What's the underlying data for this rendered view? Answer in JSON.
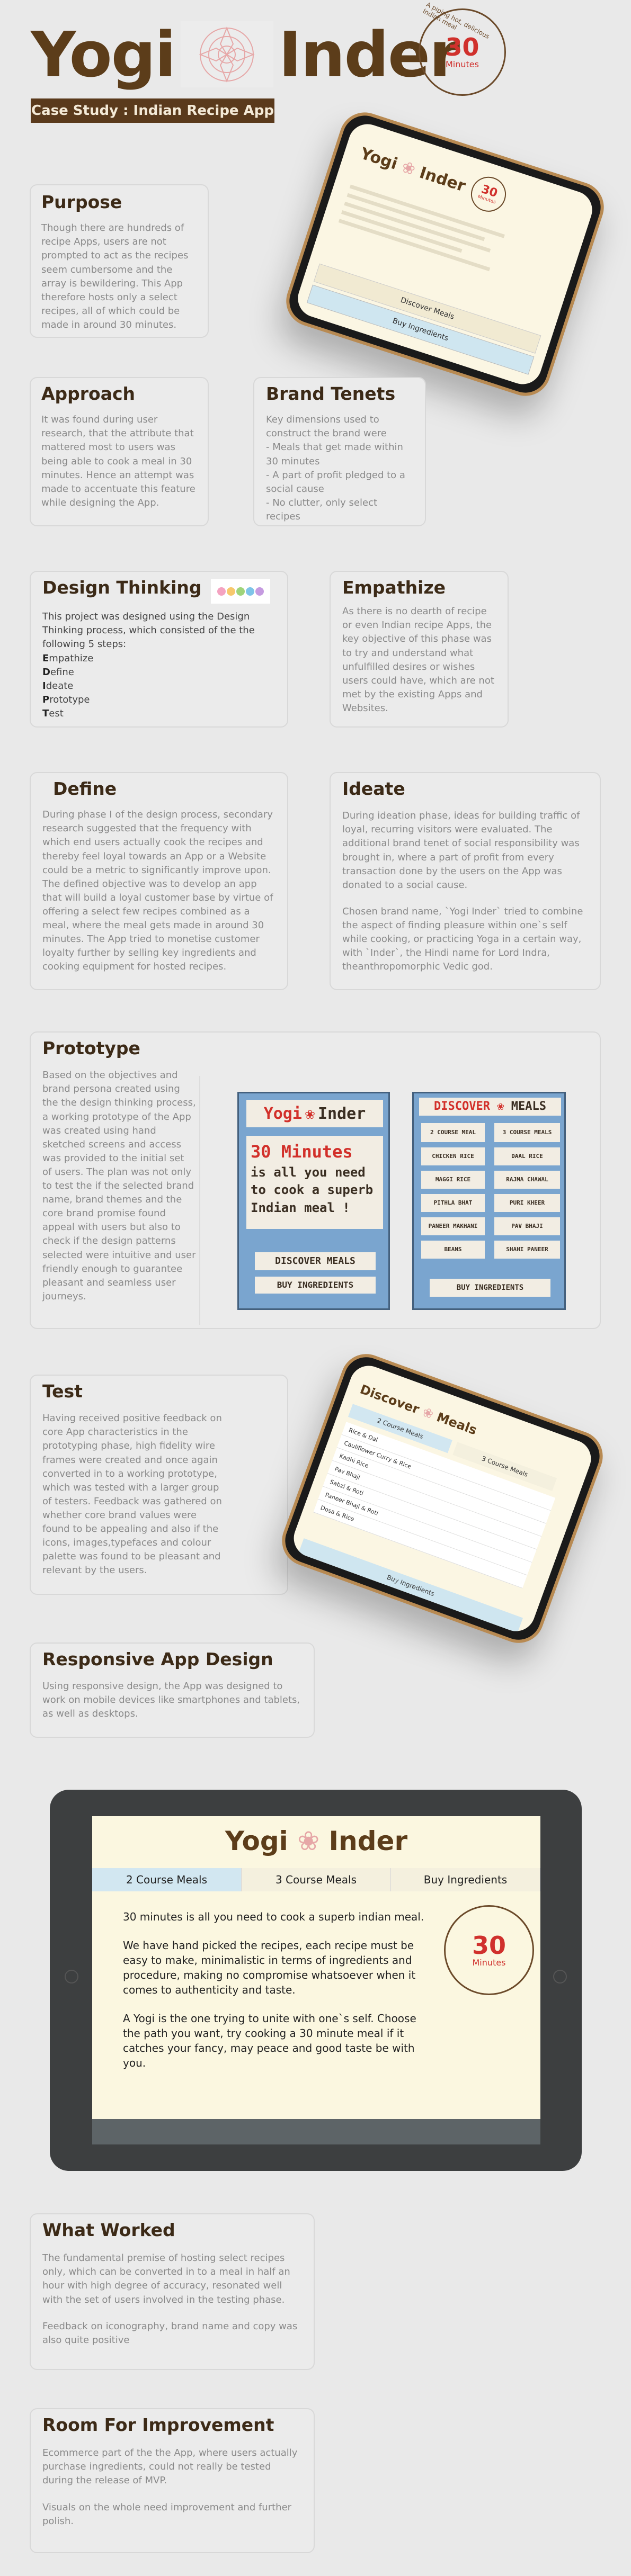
{
  "header": {
    "brand_left": "Yogi",
    "brand_right": "Inder",
    "stamp_number": "30",
    "stamp_unit": "Minutes",
    "stamp_ring": "A piping hot, delicious Indian meal",
    "banner": "Case Study : Indian Recipe App"
  },
  "purpose": {
    "title": "Purpose",
    "text": "Though there are hundreds of recipe Apps, users are not prompted to act as the recipes seem cumbersome and the array is bewildering. This App therefore hosts only a select recipes, all of which could be made in around 30 minutes."
  },
  "approach": {
    "title": "Approach",
    "text": "It was found during user research, that the attribute that mattered most to users was being able to cook a meal in 30 minutes. Hence an attempt was made to accentuate this feature while designing the App."
  },
  "brand_tenets": {
    "title": "Brand Tenets",
    "text": "Key dimensions used to construct the brand were\n- Meals that get made within 30 minutes\n- A part of profit pledged to a social cause\n- No clutter, only select recipes"
  },
  "design_thinking": {
    "title": "Design Thinking",
    "intro": "This project was designed using the Design Thinking process, which consisted of the the following 5 steps:",
    "steps": [
      {
        "initial": "E",
        "rest": "mpathize"
      },
      {
        "initial": "D",
        "rest": "efine"
      },
      {
        "initial": "I",
        "rest": "deate"
      },
      {
        "initial": "P",
        "rest": "rototype"
      },
      {
        "initial": "T",
        "rest": "est"
      }
    ]
  },
  "empathize": {
    "title": "Empathize",
    "text": "As there is no dearth of recipe or even Indian recipe Apps, the key objective of this phase was to try and understand what unfulfilled desires or wishes users could have, which are not met by the existing Apps and Websites."
  },
  "define": {
    "title": "Define",
    "text": "During phase I of the design process, secondary research suggested that the frequency with which end users actually cook the recipes and thereby feel loyal towards an App or a Website could be a metric to significantly improve upon. The defined objective was to develop an app that will build a loyal customer base by virtue of offering a select few recipes combined as a meal, where the meal gets made in around 30 minutes. The App tried to monetise customer loyalty further by selling key ingredients and cooking equipment for hosted recipes."
  },
  "ideate": {
    "title": "Ideate",
    "text1": "During ideation phase, ideas for building traffic of loyal, recurring visitors were evaluated. The additional brand tenet of social responsibility was brought in, where a part of profit from every transaction done by the users on the App was donated to a social cause.",
    "text2": "Chosen brand name, `Yogi Inder` tried to combine the aspect of finding pleasure within one`s self while cooking, or practicing Yoga in a certain way, with `Inder`, the Hindi name for Lord Indra, theanthropomorphic Vedic god."
  },
  "prototype": {
    "title": "Prototype",
    "text": "Based on the objectives and brand persona created using the the design thinking process, a working prototype of the App was created using hand sketched screens and access was provided to the initial set of users. The plan was not only to test the if the selected brand name, brand themes and the core brand promise found appeal with users but also to check if the design patterns selected were intuitive and user friendly enough to guarantee pleasant and seamless user journeys.",
    "sketch1": {
      "logo_left": "Yogi",
      "logo_right": "Inder",
      "line1": "30 Minutes",
      "line2": "is all you need",
      "line3": "to cook a superb",
      "line4": "Indian meal !",
      "btn1": "DISCOVER MEALS",
      "btn2": "BUY INGREDIENTS"
    },
    "sketch2": {
      "tab_left": "DISCOVER",
      "tab_right": "MEALS",
      "col1_head": "2 COURSE MEAL",
      "col2_head": "3 COURSE MEALS",
      "items_left": [
        "CHICKEN RICE",
        "MAGGI RICE",
        "PITHLA BHAT",
        "PANEER MAKHANI",
        "BEANS"
      ],
      "items_right": [
        "DAAL RICE",
        "RAJMA CHAWAL",
        "PURI KHEER",
        "PAV BHAJI",
        "SHAHI PANEER"
      ],
      "btn": "BUY INGREDIENTS"
    }
  },
  "test": {
    "title": "Test",
    "text": "Having received positive feedback on core App characteristics in the prototyping phase, high fidelity wire frames were created and once again converted in to a working prototype, which was tested with a larger group of testers. Feedback was gathered on whether core brand values were found to be appealing and also if the icons, images,typefaces and colour palette was found to be pleasant and relevant by the users."
  },
  "phone1": {
    "logo_left": "Yogi",
    "logo_right": "Inder",
    "btn1": "Discover Meals",
    "btn2": "Buy Ingredients"
  },
  "phone2": {
    "tab_left": "Discover",
    "tab_right": "Meals",
    "col1": "2 Course Meals",
    "col2": "3 Course Meals",
    "items": [
      "Rice & Dal",
      "Cauliflower Curry & Rice",
      "Kadhi Rice",
      "Pav Bhaji",
      "Sabzi & Roti",
      "Paneer Bhaji & Roti",
      "Dosa & Rice"
    ],
    "btn": "Buy Ingredients"
  },
  "responsive": {
    "title": "Responsive App Design",
    "text": "Using responsive design, the App was designed to work on mobile devices like smartphones and tablets, as well as desktops."
  },
  "tablet": {
    "logo_left": "Yogi",
    "logo_right": "Inder",
    "tabs": [
      "2  Course Meals",
      "3  Course Meals",
      "Buy Ingredients"
    ],
    "p1": "30 minutes  is all you need to cook a superb indian meal.",
    "p2": "We have hand picked the recipes, each recipe must be easy to make, minimalistic in terms of ingredients and procedure, making no compromise whatsoever when it comes to authenticity and taste.",
    "p3": "A Yogi is the one trying to unite with one`s self. Choose the path you want, try cooking a 30 minute meal if it catches your fancy, may peace and good taste be with you."
  },
  "what_worked": {
    "title": "What Worked",
    "text1": "The fundamental premise of hosting select recipes only, which can be converted in to a meal in half an hour with high degree of accuracy, resonated well with the set of users involved in the testing phase.",
    "text2": "Feedback on iconography, brand name and copy was also quite positive"
  },
  "improvement": {
    "title": "Room For Improvement",
    "text1": "Ecommerce part of the the App, where users actually purchase ingredients, could not really be tested during the release of MVP.",
    "text2": "Visuals on the whole need improvement and further polish."
  },
  "colors": {
    "brand_brown": "#5c3d1a",
    "accent_red": "#d0312d",
    "page_bg": "#e9e9e9",
    "card_text": "#8a8a8a"
  }
}
